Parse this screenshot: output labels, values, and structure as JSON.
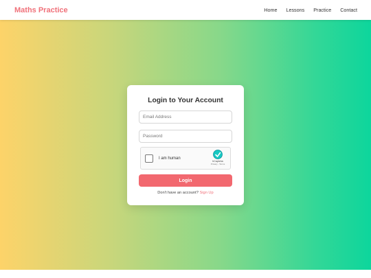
{
  "navbar": {
    "brand": "Maths Practice",
    "links": [
      {
        "label": "Home"
      },
      {
        "label": "Lessons"
      },
      {
        "label": "Practice"
      },
      {
        "label": "Contact"
      }
    ]
  },
  "login": {
    "title": "Login to Your Account",
    "email_placeholder": "Email Address",
    "email_value": "",
    "password_placeholder": "Password",
    "password_value": "",
    "captcha": {
      "label": "I am human",
      "brand": "hCaptcha",
      "links": "Privacy - Terms",
      "checked": false
    },
    "button_label": "Login",
    "signup_prompt": "Don't have an account?",
    "signup_link": "Sign Up"
  },
  "colors": {
    "brand": "#f0717a",
    "button": "#f2686f",
    "gradient_start": "#fdd369",
    "gradient_end": "#0dd69c"
  }
}
